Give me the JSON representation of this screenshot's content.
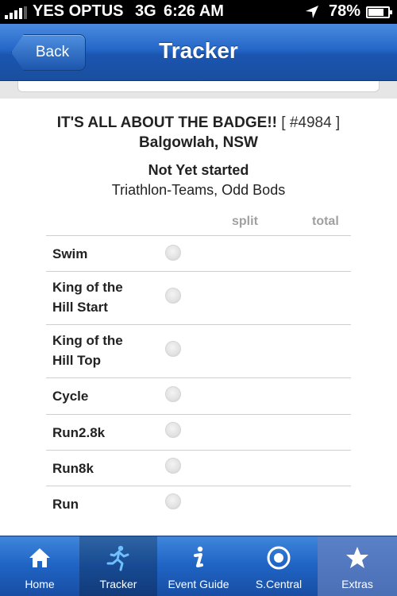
{
  "status_bar": {
    "carrier": "YES OPTUS",
    "network": "3G",
    "time": "6:26 AM",
    "battery": "78%",
    "battery_level": 0.78
  },
  "nav": {
    "back_label": "Back",
    "title": "Tracker"
  },
  "event": {
    "name": "IT'S ALL ABOUT THE BADGE!!",
    "id": "[ #4984 ]",
    "location": "Balgowlah, NSW",
    "status": "Not Yet started",
    "category": "Triathlon-Teams, Odd Bods"
  },
  "table": {
    "headers": {
      "split": "split",
      "total": "total"
    },
    "rows": [
      {
        "line1": "Swim",
        "line2": ""
      },
      {
        "line1": "King of the",
        "line2": "Hill Start"
      },
      {
        "line1": "King of the",
        "line2": "Hill Top"
      },
      {
        "line1": "Cycle",
        "line2": ""
      },
      {
        "line1": "Run2.8k",
        "line2": ""
      },
      {
        "line1": "Run8k",
        "line2": ""
      },
      {
        "line1": "Run",
        "line2": ""
      }
    ]
  },
  "tabs": [
    {
      "label": "Home",
      "icon": "home-icon"
    },
    {
      "label": "Tracker",
      "icon": "runner-icon",
      "selected": true
    },
    {
      "label": "Event Guide",
      "icon": "info-icon"
    },
    {
      "label": "S.Central",
      "icon": "target-icon"
    },
    {
      "label": "Extras",
      "icon": "star-icon"
    }
  ]
}
